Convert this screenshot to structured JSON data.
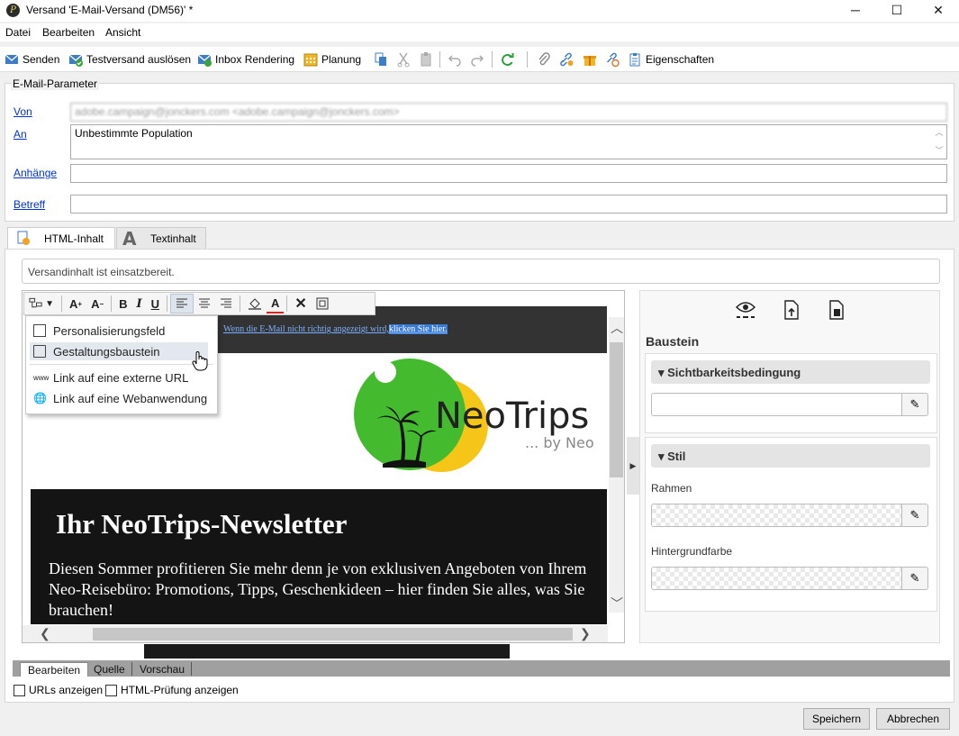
{
  "window": {
    "title": "Versand 'E-Mail-Versand (DM56)' *",
    "minimize": "─",
    "maximize": "☐",
    "close": "✕"
  },
  "menu": [
    "Datei",
    "Bearbeiten",
    "Ansicht"
  ],
  "toolbar": {
    "send": "Senden",
    "test_send": "Testversand auslösen",
    "inbox_rendering": "Inbox Rendering",
    "planning": "Planung",
    "properties": "Eigenschaften"
  },
  "params": {
    "legend": "E-Mail-Parameter",
    "from_label": "Von",
    "from_value": "adobe.campaign@jonckers.com <adobe.campaign@jonckers.com>",
    "to_label": "An",
    "to_value": "Unbestimmte Population",
    "attachments_label": "Anhänge",
    "attachments_value": "",
    "subject_label": "Betreff",
    "subject_value": ""
  },
  "tabs": [
    "HTML-Inhalt",
    "Textinhalt"
  ],
  "status_message": "Versandinhalt ist einsatzbereit.",
  "email": {
    "top_link_text": "Wenn die E-Mail nicht richtig angezeigt wird,",
    "top_link_selected": "klicken Sie hier.",
    "logo_name": "NeoTrips",
    "logo_sub": "... by Neo",
    "headline": "Ihr NeoTrips-Newsletter",
    "body": "Diesen Sommer profitieren Sie mehr denn je von exklusiven Angeboten von Ihrem Neo-Reisebüro: Promotions, Tipps, Geschenkideen – hier finden Sie alles, was Sie brauchen!"
  },
  "insert_menu": {
    "items": [
      "Personalisierungsfeld",
      "Gestaltungsbaustein",
      "Link auf eine externe URL",
      "Link auf eine Webanwendung"
    ],
    "highlighted_index": 1
  },
  "right_panel": {
    "title": "Baustein",
    "visibility_section": "Sichtbarkeitsbedingung",
    "style_section": "Stil",
    "border_label": "Rahmen",
    "bg_label": "Hintergrundfarbe"
  },
  "bottom_tabs": [
    "Bearbeiten",
    "Quelle",
    "Vorschau"
  ],
  "checkboxes": {
    "show_urls": "URLs anzeigen",
    "html_check": "HTML-Prüfung anzeigen"
  },
  "buttons": {
    "save": "Speichern",
    "cancel": "Abbrechen"
  },
  "colors": {
    "link_blue": "#0033cc",
    "logo_green": "#44bb2e",
    "logo_yellow": "#f5c518",
    "email_dark": "#141414"
  }
}
